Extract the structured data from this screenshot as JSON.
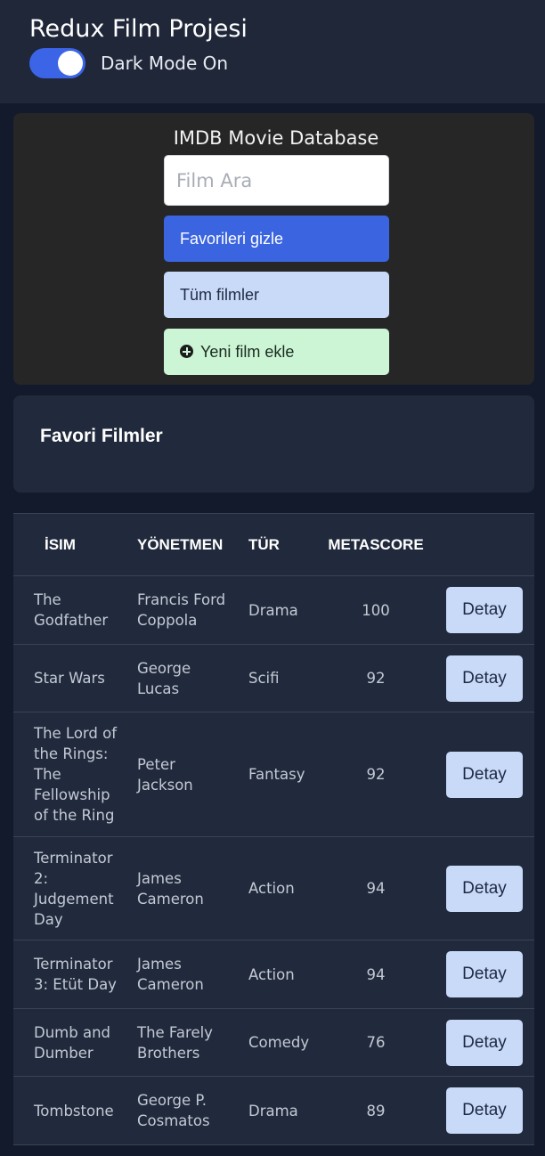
{
  "header": {
    "title": "Redux Film Projesi",
    "dark_mode_label": "Dark Mode On",
    "dark_mode_on": true
  },
  "search_panel": {
    "title": "IMDB Movie Database",
    "search_placeholder": "Film Ara",
    "search_value": "",
    "hide_favorites_label": "Favorileri gizle",
    "all_movies_label": "Tüm filmler",
    "add_movie_label": "Yeni film ekle"
  },
  "favorites": {
    "title": "Favori Filmler"
  },
  "movies_table": {
    "headers": [
      "İSIM",
      "YÖNETMEN",
      "TÜR",
      "METASCORE",
      ""
    ],
    "rows": [
      {
        "name": "The Godfather",
        "director": "Francis Ford Coppola",
        "genre": "Drama",
        "metascore": "100",
        "action": "Detay"
      },
      {
        "name": "Star Wars",
        "director": "George Lucas",
        "genre": "Scifi",
        "metascore": "92",
        "action": "Detay"
      },
      {
        "name": "The Lord of the Rings: The Fellowship of the Ring",
        "director": "Peter Jackson",
        "genre": "Fantasy",
        "metascore": "92",
        "action": "Detay"
      },
      {
        "name": "Terminator 2: Judgement Day",
        "director": "James Cameron",
        "genre": "Action",
        "metascore": "94",
        "action": "Detay"
      },
      {
        "name": "Terminator 3: Etüt Day",
        "director": "James Cameron",
        "genre": "Action",
        "metascore": "94",
        "action": "Detay"
      },
      {
        "name": "Dumb and Dumber",
        "director": "The Farely Brothers",
        "genre": "Comedy",
        "metascore": "76",
        "action": "Detay"
      },
      {
        "name": "Tombstone",
        "director": "George P. Cosmatos",
        "genre": "Drama",
        "metascore": "89",
        "action": "Detay"
      }
    ]
  }
}
